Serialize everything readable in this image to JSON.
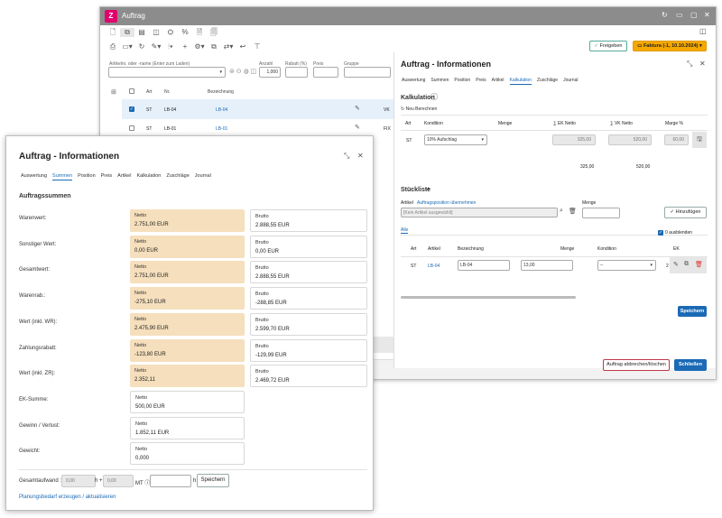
{
  "back": {
    "title": "Auftrag",
    "controls": [
      "↻",
      "▭",
      "▢",
      "✕"
    ],
    "toolbar1": [
      "🗋",
      "⧉",
      "▤",
      "◫",
      "⛭",
      "%",
      "🗎",
      "🗐"
    ],
    "toolbar2": [
      "⎙",
      "▭▾",
      "↻",
      "✎▾",
      "⦙▾",
      "+",
      "⚙▾",
      "⧉",
      "⇄▾",
      "↩",
      "⊤"
    ],
    "freigeben": "Freigeben",
    "faktura": "Faktura (-1, 10.10.2024)",
    "filter": {
      "artikel_label": "Artikelnr. oder -name (Enter zum Laden)",
      "anzahl_label": "Anzahl",
      "anzahl_value": "1,000",
      "rabatt_label": "Rabatt (%)",
      "preis_label": "Preis",
      "gruppe_label": "Gruppe"
    },
    "table": {
      "headers": [
        "Art",
        "Nr.",
        "Bezeichnung"
      ],
      "rows": [
        {
          "art": "ST",
          "nr": "LB-04",
          "bez": "LB-04",
          "tail": "VK"
        },
        {
          "art": "ST",
          "nr": "LB-01",
          "bez": "LB-01",
          "tail": "FIX"
        }
      ]
    }
  },
  "info": {
    "title": "Auftrag - Informationen",
    "tabs": [
      "Auswertung",
      "Summen",
      "Position",
      "Preis",
      "Artikel",
      "Kalkulation",
      "Zuschläge",
      "Journal"
    ],
    "kalkulation": "Kalkulation",
    "neu_berechnen": "Neu Berechnen",
    "kalk_headers": [
      "Art",
      "Kondition",
      "Menge",
      "∑ EK Netto",
      "∑ VK Netto",
      "Marge %"
    ],
    "kalk_row": {
      "art": "ST",
      "kondition": "10% Aufschlag",
      "ek": "325,00",
      "vk": "520,00",
      "marge": "60,00"
    },
    "kalk_sum": {
      "ek": "325,00",
      "vk": "520,00"
    },
    "stueckliste": "Stückliste",
    "artikel_label": "Artikel",
    "uebernehmen": "Auftragsposition übernehmen",
    "kein_artikel": "[Kein Artikel ausgewählt]",
    "menge_label": "Menge",
    "hinzufuegen": "Hinzufügen",
    "alle": "Alle",
    "ausblenden": "0 ausblenden",
    "st_headers": [
      "Art",
      "Artikel",
      "Bezeichnung",
      "Menge",
      "Kondition",
      "EK"
    ],
    "st_row": {
      "art": "ST",
      "artikel": "LB-04",
      "bez": "LB-04",
      "menge": "13,00",
      "kondition": "--",
      "ek": "2"
    },
    "speichern": "Speichern",
    "abbrechen": "Auftrag abbrechen/löschen",
    "schliessen": "Schließen"
  },
  "front": {
    "title": "Auftrag - Informationen",
    "tabs": [
      "Auswertung",
      "Summen",
      "Position",
      "Preis",
      "Artikel",
      "Kalkulation",
      "Zuschläge",
      "Journal"
    ],
    "section": "Auftragssummen",
    "rows": [
      {
        "label": "Warenwert:",
        "netto_label": "Netto",
        "netto": "2.751,00 EUR",
        "brutto_label": "Brutto",
        "brutto": "2.888,55 EUR",
        "hl": true
      },
      {
        "label": "Sonstiger Wert:",
        "netto_label": "Netto",
        "netto": "0,00 EUR",
        "brutto_label": "Brutto",
        "brutto": "0,00 EUR",
        "hl": true
      },
      {
        "label": "Gesamtwert:",
        "netto_label": "Netto",
        "netto": "2.751,00 EUR",
        "brutto_label": "Brutto",
        "brutto": "2.888,55 EUR",
        "hl": true
      },
      {
        "label": "Warenrab.:",
        "netto_label": "Netto",
        "netto": "-275,10 EUR",
        "brutto_label": "Brutto",
        "brutto": "-288,85 EUR",
        "hl": true
      },
      {
        "label": "Wert (inkl. WR):",
        "netto_label": "Netto",
        "netto": "2.475,90 EUR",
        "brutto_label": "Brutto",
        "brutto": "2.599,70 EUR",
        "hl": true
      },
      {
        "label": "Zahlungsrabatt:",
        "netto_label": "Netto",
        "netto": "-123,80 EUR",
        "brutto_label": "Brutto",
        "brutto": "-129,99 EUR",
        "hl": true
      },
      {
        "label": "Wert (inkl. ZR):",
        "netto_label": "Netto",
        "netto": "2.352,11",
        "brutto_label": "Brutto",
        "brutto": "2.469,72 EUR",
        "hl": true
      },
      {
        "label": "EK-Summe:",
        "netto_label": "Netto",
        "netto": "500,00 EUR",
        "hl": false
      },
      {
        "label": "Gewinn / Verlust:",
        "netto_label": "Netto",
        "netto": "1.852,11 EUR",
        "hl": false
      },
      {
        "label": "Gewicht:",
        "netto_label": "Netto",
        "netto": "0,000",
        "hl": false
      }
    ],
    "gesamtaufwand": "Gesamtaufwand :",
    "h_val1": "0,00",
    "h_sep": "h +",
    "h_val2": "0,00",
    "mt": "MT ⓘ",
    "h": "h",
    "speichern": "Speichern",
    "link": "Planungsbedarf erzeugen / aktualisieren"
  }
}
